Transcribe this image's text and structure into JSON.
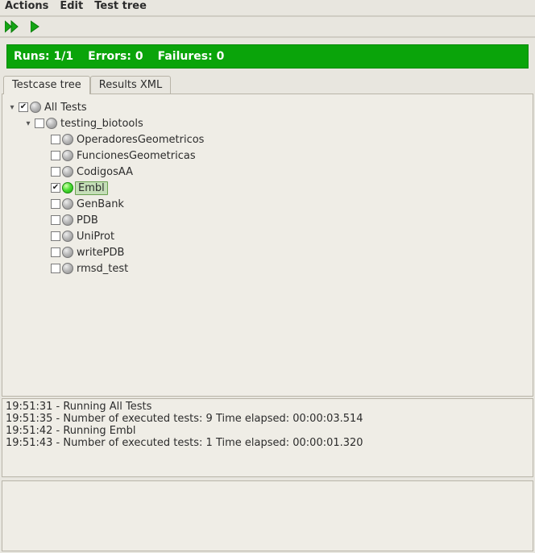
{
  "menu": {
    "actions": "Actions",
    "edit": "Edit",
    "testtree": "Test tree"
  },
  "status": {
    "runs_label": "Runs:",
    "runs_value": "1/1",
    "errors_label": "Errors:",
    "errors_value": "0",
    "failures_label": "Failures:",
    "failures_value": "0"
  },
  "tabs": {
    "tree": "Testcase tree",
    "results": "Results XML"
  },
  "tree": {
    "root": {
      "label": "All Tests",
      "checked": true,
      "expanded": true,
      "status": "grey"
    },
    "suite": {
      "label": "testing_biotools",
      "checked": false,
      "expanded": true,
      "status": "grey"
    },
    "items": [
      {
        "label": "OperadoresGeometricos",
        "checked": false,
        "status": "grey",
        "selected": false
      },
      {
        "label": "FuncionesGeometricas",
        "checked": false,
        "status": "grey",
        "selected": false
      },
      {
        "label": "CodigosAA",
        "checked": false,
        "status": "grey",
        "selected": false
      },
      {
        "label": "Embl",
        "checked": true,
        "status": "green",
        "selected": true
      },
      {
        "label": "GenBank",
        "checked": false,
        "status": "grey",
        "selected": false
      },
      {
        "label": "PDB",
        "checked": false,
        "status": "grey",
        "selected": false
      },
      {
        "label": "UniProt",
        "checked": false,
        "status": "grey",
        "selected": false
      },
      {
        "label": "writePDB",
        "checked": false,
        "status": "grey",
        "selected": false
      },
      {
        "label": "rmsd_test",
        "checked": false,
        "status": "grey",
        "selected": false
      }
    ]
  },
  "log": [
    "19:51:31 - Running All Tests",
    "19:51:35 - Number of executed tests: 9  Time elapsed: 00:00:03.514",
    "19:51:42 - Running Embl",
    "19:51:43 - Number of executed tests: 1  Time elapsed: 00:00:01.320"
  ]
}
